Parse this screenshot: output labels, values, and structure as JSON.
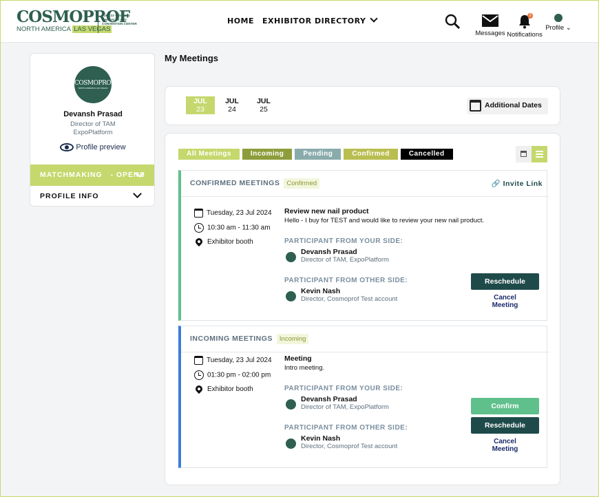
{
  "header": {
    "logo": {
      "word": "COSMOPROF",
      "sub_left": "NORTH AMERICA",
      "sub_right": "LAS VEGAS",
      "info": "JULY 23 – 25, 2024 MANDALAY BAY CONVENTION CENTER"
    },
    "nav": {
      "home": "HOME",
      "directory": "EXHIBITOR DIRECTORY"
    },
    "messages_label": "Messages",
    "notifications_label": "Notifications",
    "notifications_count": "0",
    "profile_label": "Profile"
  },
  "sidebar": {
    "avatar_word": "COSMOPROF",
    "avatar_sub": "NORTH AMERICA LAS VEGAS",
    "name": "Devansh Prasad",
    "title_line1": "Director of TAM",
    "title_line2": "ExpoPlatform",
    "preview_label": "Profile preview",
    "matchmaking_label": "MATCHMAKING   - OPENS",
    "profile_info_label": "PROFILE INFO"
  },
  "main": {
    "title": "My Meetings",
    "dates": [
      {
        "month": "JUL",
        "day": "23",
        "active": true
      },
      {
        "month": "JUL",
        "day": "24",
        "active": false
      },
      {
        "month": "JUL",
        "day": "25",
        "active": false
      }
    ],
    "additional_dates": "Additional Dates",
    "filters": [
      {
        "label": "All Meetings",
        "color": "#c5d86d"
      },
      {
        "label": "Incoming",
        "color": "#8e9d3b"
      },
      {
        "label": "Pending",
        "color": "#8aabab"
      },
      {
        "label": "Confirmed",
        "color": "#b9be50"
      },
      {
        "label": "Cancelled",
        "color": "#000000"
      }
    ],
    "confirmed": {
      "heading": "CONFIRMED MEETINGS",
      "tag": "Confirmed",
      "invite_link": "Invite Link",
      "date": "Tuesday, 23 Jul 2024",
      "time": "10:30 am - 11:30 am",
      "location": "Exhibitor booth",
      "meeting_title": "Review new nail product",
      "meeting_desc": "Hello - I buy for TEST and would like to review your new nail product.",
      "your_side_label": "PARTICIPANT FROM YOUR SIDE:",
      "your_name": "Devansh Prasad",
      "your_role": "Director of TAM, ExpoPlatform",
      "other_side_label": "PARTICIPANT FROM OTHER SIDE:",
      "other_name": "Kevin Nash",
      "other_role": "Director, Cosmoprof Test account",
      "reschedule": "Reschedule",
      "cancel_line1": "Cancel",
      "cancel_line2": "Meeting",
      "accent": "#5fc08c"
    },
    "incoming": {
      "heading": "INCOMING MEETINGS",
      "tag": "Incoming",
      "date": "Tuesday, 23 Jul 2024",
      "time": "01:30 pm - 02:00 pm",
      "location": "Exhibitor booth",
      "meeting_title": "Meeting",
      "meeting_desc": "Intro meeting.",
      "your_side_label": "PARTICIPANT FROM YOUR SIDE:",
      "your_name": "Devansh Prasad",
      "your_role": "Director of TAM, ExpoPlatform",
      "other_side_label": "PARTICIPANT FROM OTHER SIDE:",
      "other_name": "Kevin Nash",
      "other_role": "Director, Cosmoprof Test account",
      "confirm": "Confirm",
      "reschedule": "Reschedule",
      "cancel_line1": "Cancel",
      "cancel_line2": "Meeting",
      "accent": "#3b7fd9"
    }
  }
}
